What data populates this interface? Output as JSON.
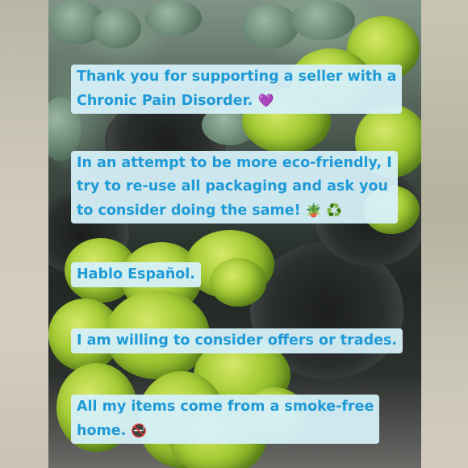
{
  "messages": [
    {
      "line1": "Thank you for supporting a seller with a",
      "line2": "Chronic Pain Disorder.",
      "emoji2": "💜"
    },
    {
      "line1": "In an attempt to be more eco-friendly, I",
      "line2": "try to re-use all packaging and ask you",
      "line3": "to consider doing the same!",
      "emoji3": "🪴 ♻️"
    },
    {
      "line1": "Hablo Español."
    },
    {
      "line1": "I am willing to consider offers or trades."
    },
    {
      "line1": "All my items come from a smoke-free",
      "line2": "home.",
      "emoji2": "🚭"
    }
  ],
  "colors": {
    "text": "#1f9ad6",
    "bubble": "#d6f0f9"
  },
  "photo_subject": "peperomia-plants-in-nursery-pots"
}
